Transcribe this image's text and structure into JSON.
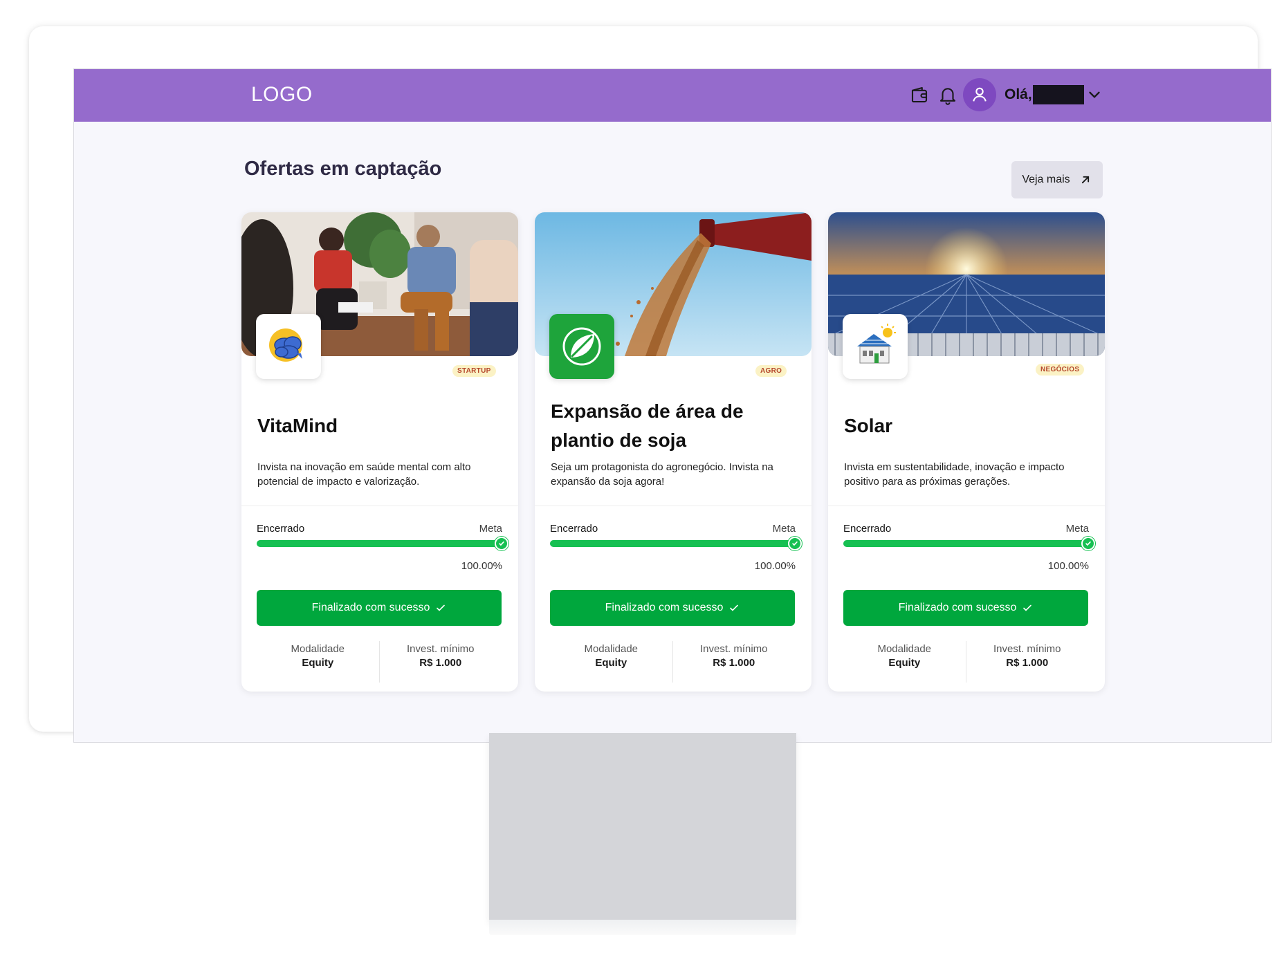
{
  "header": {
    "logo": "LOGO",
    "greeting": "Olá,",
    "bg_color": "#956bcc",
    "icons": [
      "wallet-icon",
      "bell-icon",
      "user-icon",
      "chevron-down-icon"
    ]
  },
  "section": {
    "title": "Ofertas em captação",
    "see_more_label": "Veja mais"
  },
  "cards": [
    {
      "tag": "STARTUP",
      "title": "VitaMind",
      "description": "Invista na inovação em saúde mental com alto potencial de impacto e valorização.",
      "status_label": "Encerrado",
      "goal_label": "Meta",
      "progress": 1.0,
      "progress_text": "100.00%",
      "cta_label": "Finalizado com sucesso",
      "modality_label": "Modalidade",
      "modality_value": "Equity",
      "min_invest_label": "Invest. mínimo",
      "min_invest_value": "R$ 1.000",
      "logo_icon": "brain-icon"
    },
    {
      "tag": "AGRO",
      "title": "Expansão de área de plantio de soja",
      "description": "Seja um protagonista do agronegócio. Invista na expansão da soja agora!",
      "status_label": "Encerrado",
      "goal_label": "Meta",
      "progress": 1.0,
      "progress_text": "100.00%",
      "cta_label": "Finalizado com sucesso",
      "modality_label": "Modalidade",
      "modality_value": "Equity",
      "min_invest_label": "Invest. mínimo",
      "min_invest_value": "R$ 1.000",
      "logo_icon": "leaf-icon"
    },
    {
      "tag": "NEGÓCIOS",
      "title": "Solar",
      "description": "Invista em sustentabilidade, inovação e impacto positivo para as próximas gerações.",
      "status_label": "Encerrado",
      "goal_label": "Meta",
      "progress": 1.0,
      "progress_text": "100.00%",
      "cta_label": "Finalizado com sucesso",
      "modality_label": "Modalidade",
      "modality_value": "Equity",
      "min_invest_label": "Invest. mínimo",
      "min_invest_value": "R$ 1.000",
      "logo_icon": "solar-house-icon"
    }
  ],
  "colors": {
    "accent_green": "#00a73d",
    "progress_green": "#16c052",
    "tag_bg": "#fbf2c5",
    "tag_text": "#b5472b"
  }
}
